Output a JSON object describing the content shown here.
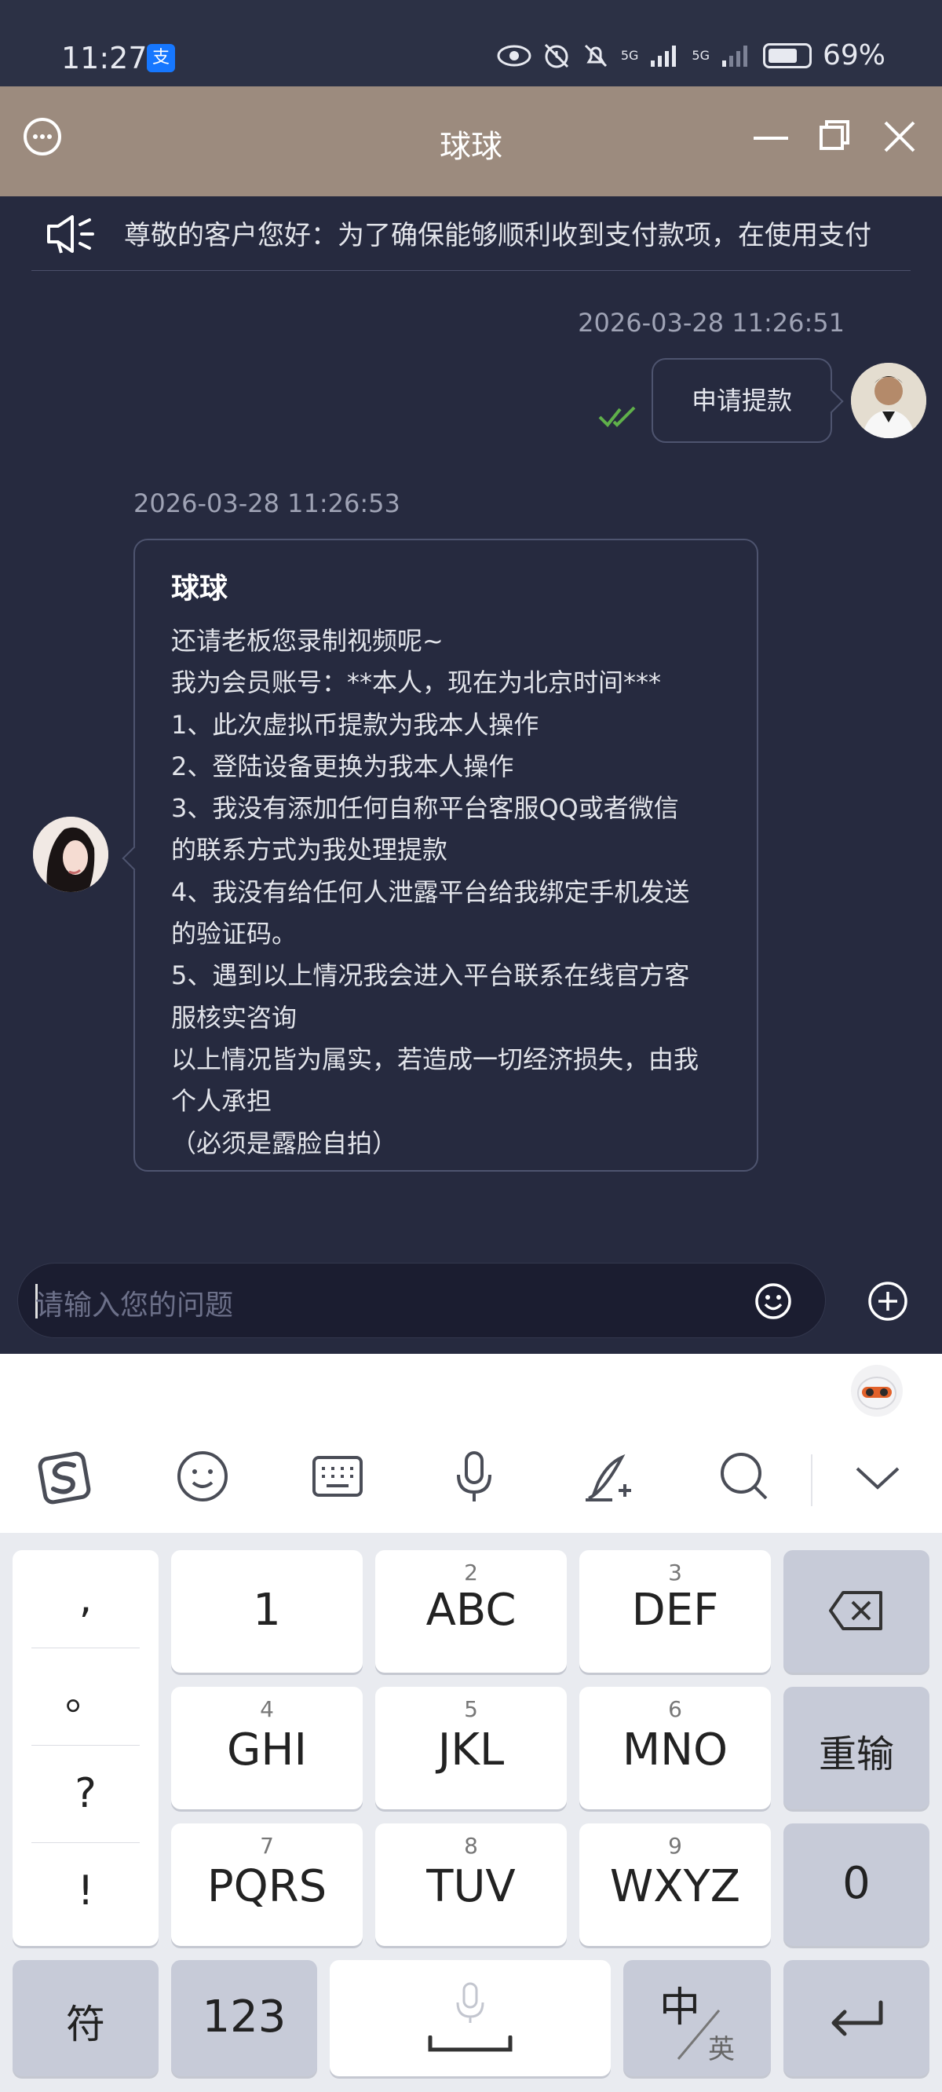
{
  "status_bar": {
    "time": "11:27",
    "alipay_glyph": "支",
    "network_1": "5G",
    "network_2": "5G",
    "battery": "69%",
    "icons": [
      "eye-icon",
      "alarm-icon",
      "mute-icon",
      "signal-icon",
      "signal-icon",
      "battery-icon"
    ]
  },
  "titlebar": {
    "title": "球球"
  },
  "notice": {
    "text": "尊敬的客户您好：为了确保能够顺利收到支付款项，在使用支付"
  },
  "chat": {
    "outgoing": {
      "timestamp": "2026-03-28 11:26:51",
      "text": "申请提款"
    },
    "incoming": {
      "timestamp": "2026-03-28 11:26:53",
      "sender": "球球",
      "lines": [
        "还请老板您录制视频呢~",
        "我为会员账号：**本人，现在为北京时间***",
        "1、此次虚拟币提款为我本人操作",
        "2、登陆设备更换为我本人操作",
        "3、我没有添加任何自称平台客服QQ或者微信",
        "的联系方式为我处理提款",
        "4、我没有给任何人泄露平台给我绑定手机发送",
        "的验证码。",
        "5、遇到以上情况我会进入平台联系在线官方客",
        "服核实咨询",
        "以上情况皆为属实，若造成一切经济损失，由我",
        "个人承担",
        "（必须是露脸自拍）"
      ]
    }
  },
  "input": {
    "placeholder": "请输入您的问题"
  },
  "keyboard": {
    "punct": [
      ",",
      "。",
      "?",
      "!"
    ],
    "rows": [
      [
        {
          "num": "",
          "label": "1"
        },
        {
          "num": "2",
          "label": "ABC"
        },
        {
          "num": "3",
          "label": "DEF"
        }
      ],
      [
        {
          "num": "4",
          "label": "GHI"
        },
        {
          "num": "5",
          "label": "JKL"
        },
        {
          "num": "6",
          "label": "MNO"
        }
      ],
      [
        {
          "num": "7",
          "label": "PQRS"
        },
        {
          "num": "8",
          "label": "TUV"
        },
        {
          "num": "9",
          "label": "WXYZ"
        }
      ]
    ],
    "reinput": "重输",
    "zero": "0",
    "symbols": "符",
    "numbers": "123",
    "lang_main": "中",
    "lang_alt": "英"
  }
}
